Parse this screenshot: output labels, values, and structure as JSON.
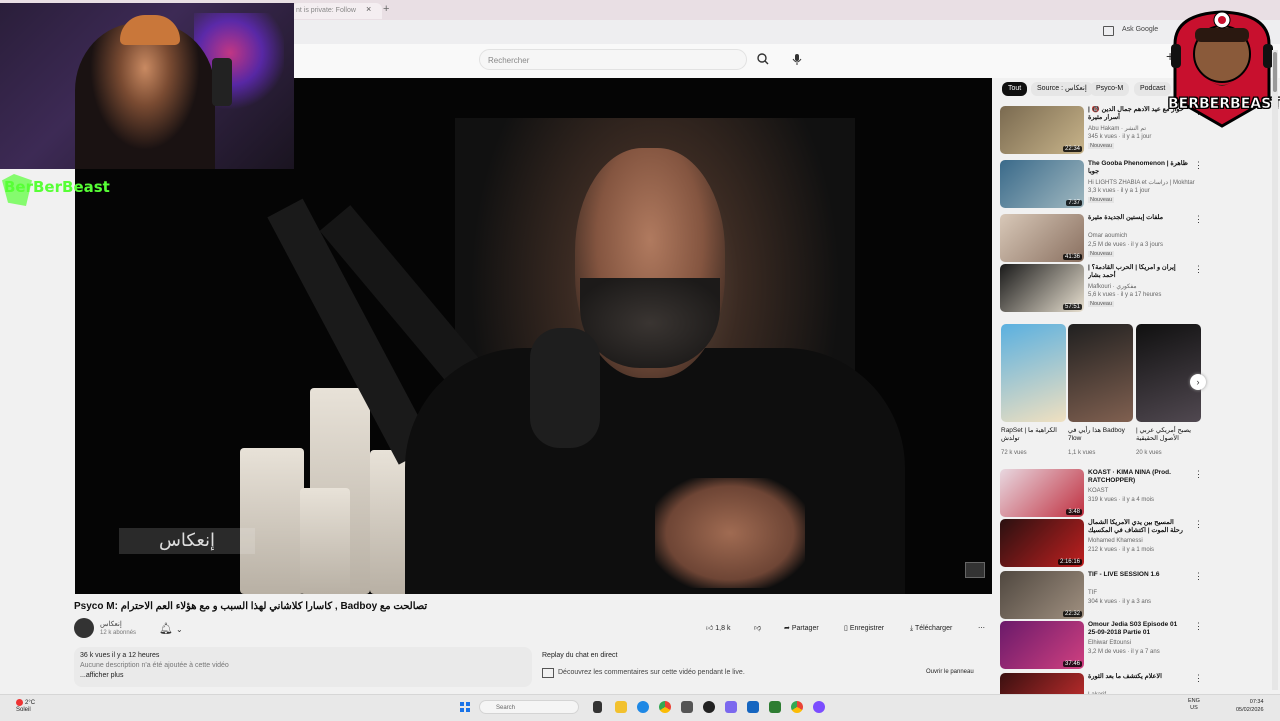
{
  "browser": {
    "tab_title": "nt is private: Follow",
    "tab_close": "×",
    "new_tab": "+",
    "ask_google": "Ask Google"
  },
  "header": {
    "search_placeholder": "Rechercher"
  },
  "overlay": {
    "streamer_name": "BerBerBeast",
    "logo_text": "BERBERBEAST"
  },
  "video": {
    "watermark": "إنعكاس",
    "title": "Psyco M: كاسارا كلاشاني لهذا السبب و مع هؤلاء العم الاحترام , Badboy تصالحت مع",
    "channel_name": "إنعكاس",
    "channel_subs": "12 k abonnés",
    "likes": "1,8 k",
    "share": "Partager",
    "save": "Enregistrer",
    "download": "Télécharger",
    "views_line": "36 k vues  il y a 12 heures",
    "no_desc": "Aucune description n'a été ajoutée à cette vidéo",
    "show_more": "...afficher plus"
  },
  "chat": {
    "title": "Replay du chat en direct",
    "desc": "Découvrez les commentaires sur cette vidéo pendant le live.",
    "open": "Ouvrir le panneau"
  },
  "chips": [
    "Tout",
    "Source : إنعكاس",
    "Psyco-M",
    "Podcast"
  ],
  "recommendations": [
    {
      "title": "حوار مع عيد الأدهم جمال الدين 🔞 | أسرار مثيرة",
      "channel": "Abu Hakam · تم النشر",
      "meta": "345 k vues · il y a 1 jour",
      "badge": "Nouveau",
      "duration": "22:34",
      "colors": [
        "#7a6a50",
        "#c8b48a"
      ]
    },
    {
      "title": "The Gooba Phenomenon | ظاهرة جوبا",
      "channel": "Hi LIGHTS ZHABIA et دراسات | Mokhtar",
      "meta": "3,3 k vues · il y a 1 jour",
      "badge": "Nouveau",
      "duration": "7:37",
      "colors": [
        "#3a6a8a",
        "#a0b8c0"
      ]
    },
    {
      "title": "ملفات إبستين الجديدة مثيرة",
      "channel": "Omar aoumich",
      "meta": "2,5 M de vues · il y a 3 jours",
      "badge": "Nouveau",
      "duration": "41:36",
      "colors": [
        "#d8c8b8",
        "#8a7060"
      ]
    },
    {
      "title": "إيران و أمريكا | الحرب القادمة؟ | أحمد بشار",
      "channel": "Mafkouri · مفكوري",
      "meta": "5,6 k vues · il y a 17 heures",
      "badge": "Nouveau",
      "duration": "57:51",
      "colors": [
        "#1a1a1a",
        "#e8e0d0"
      ]
    },
    {
      "title": "KOAST · KIMA NINA (Prod. RATCHOPPER)",
      "channel": "KOAST",
      "meta": "319 k vues · il y a 4 mois",
      "badge": "",
      "duration": "3:48",
      "colors": [
        "#e8d8e0",
        "#c03040"
      ]
    },
    {
      "title": "المسيح بين يدي الأمريكا الشمال رحلة الموت | اكتشاف في المكسيك",
      "channel": "Mohamed Khamessi",
      "meta": "212 k vues · il y a 1 mois",
      "badge": "",
      "duration": "2:16:16",
      "colors": [
        "#2a1010",
        "#c02020"
      ]
    },
    {
      "title": "TIF - LIVE SESSION 1.6",
      "channel": "TIF",
      "meta": "304 k vues · il y a 3 ans",
      "badge": "",
      "duration": "22:32",
      "colors": [
        "#504840",
        "#a09080"
      ]
    },
    {
      "title": "Omour Jedia S03 Episode 01 25-09-2018 Partie 01",
      "channel": "Elhiwar Ettounsi",
      "meta": "3,2 M de vues · il y a 7 ans",
      "badge": "",
      "duration": "37:46",
      "colors": [
        "#6a1a6a",
        "#d04080"
      ]
    },
    {
      "title": "الاعلام يكتشف ما بعد الثورة",
      "channel": "Lakarif",
      "meta": "",
      "badge": "",
      "duration": "",
      "colors": [
        "#3a1010",
        "#d03030"
      ]
    }
  ],
  "shorts": [
    {
      "title": "RapSet | الكراهية ما تولدش",
      "views": "72 k vues",
      "colors": [
        "#5ab0e0",
        "#f0e0c0"
      ]
    },
    {
      "title": "هذا رأيي في Badboy 7low",
      "views": "1,1 k vues",
      "colors": [
        "#202020",
        "#806050"
      ]
    },
    {
      "title": "يصبح أمريكي عربي | الأصول الحقيقية",
      "views": "20 k vues",
      "colors": [
        "#101010",
        "#504850"
      ]
    }
  ],
  "taskbar": {
    "temp": "2°C",
    "weather": "Soleil",
    "search": "Search",
    "lang1": "ENG",
    "lang2": "US",
    "time": "07:34",
    "date": "05/02/2026"
  },
  "colors": {
    "accent_green": "#57ff36",
    "logo_red": "#c8102e"
  }
}
